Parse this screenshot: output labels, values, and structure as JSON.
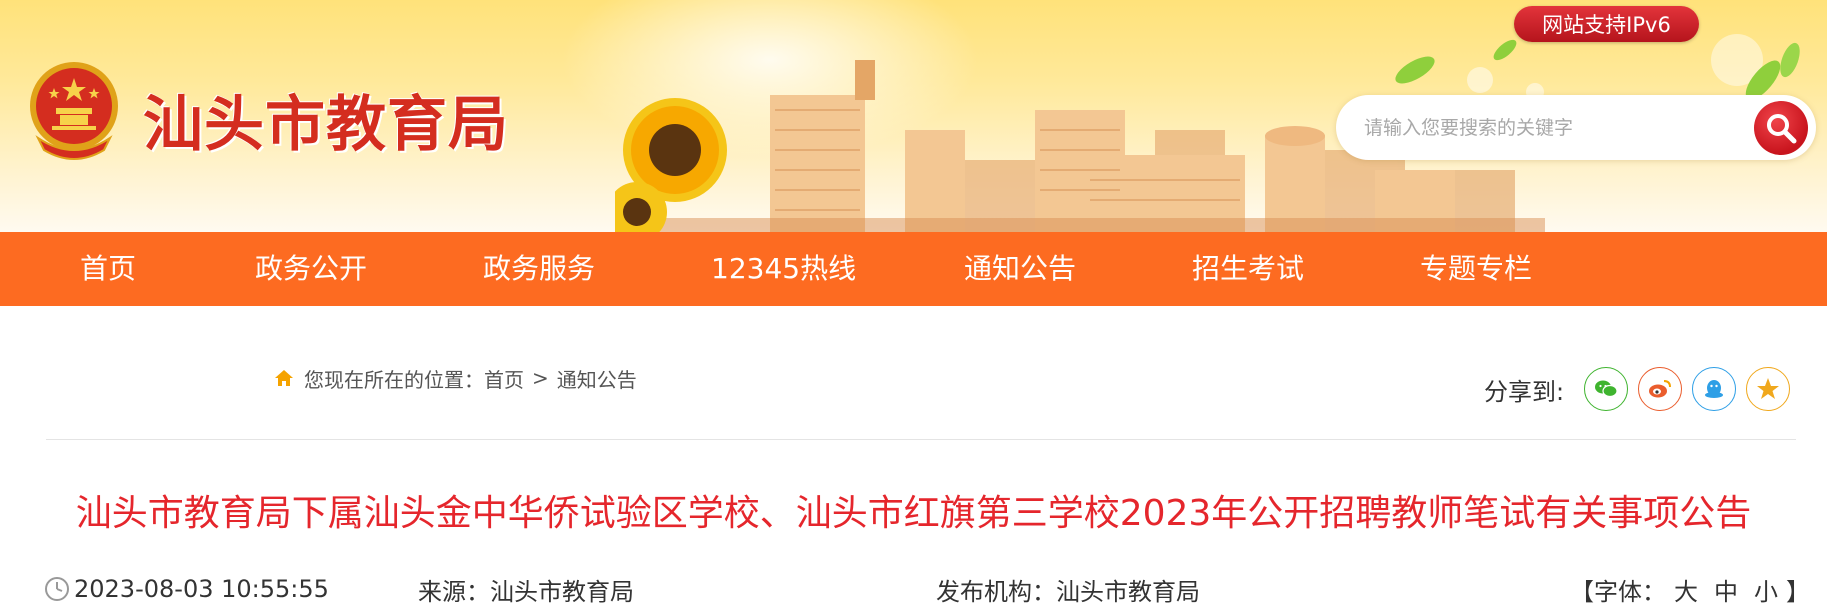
{
  "header": {
    "site_title": "汕头市教育局",
    "ipv6_badge": "网站支持IPv6",
    "search": {
      "placeholder": "请输入您要搜索的关键字",
      "icon": "search-icon"
    },
    "colors": {
      "title_red": "#d42d1f",
      "badge_red": "#c8141d",
      "banner_yellow": "#ffe27a"
    }
  },
  "nav": {
    "color": "#fd6b21",
    "items": [
      "首页",
      "政务公开",
      "政务服务",
      "12345热线",
      "通知公告",
      "招生考试",
      "专题专栏"
    ]
  },
  "breadcrumb": {
    "prefix": "您现在所在的位置：",
    "home": "首页",
    "separator": ">",
    "current": "通知公告"
  },
  "share": {
    "label": "分享到:",
    "targets": [
      {
        "name": "wechat",
        "icon": "wechat-icon",
        "color": "#3fb42f"
      },
      {
        "name": "weibo",
        "icon": "weibo-icon",
        "color": "#ea5d2d"
      },
      {
        "name": "qq",
        "icon": "qq-icon",
        "color": "#2e9fe6"
      },
      {
        "name": "qzone",
        "icon": "qzone-star-icon",
        "color": "#f0a81d"
      }
    ]
  },
  "article": {
    "title": "汕头市教育局下属汕头金中华侨试验区学校、汕头市红旗第三学校2023年公开招聘教师笔试有关事项公告",
    "title_color": "#e5262c",
    "date": "2023-08-03 10:55:55",
    "source_label": "来源：",
    "source_value": "汕头市教育局",
    "publisher_label": "发布机构：",
    "publisher_value": "汕头市教育局",
    "font_size": {
      "open": "【字体：",
      "large": "大",
      "medium": "中",
      "small": "小",
      "close": "】"
    }
  }
}
